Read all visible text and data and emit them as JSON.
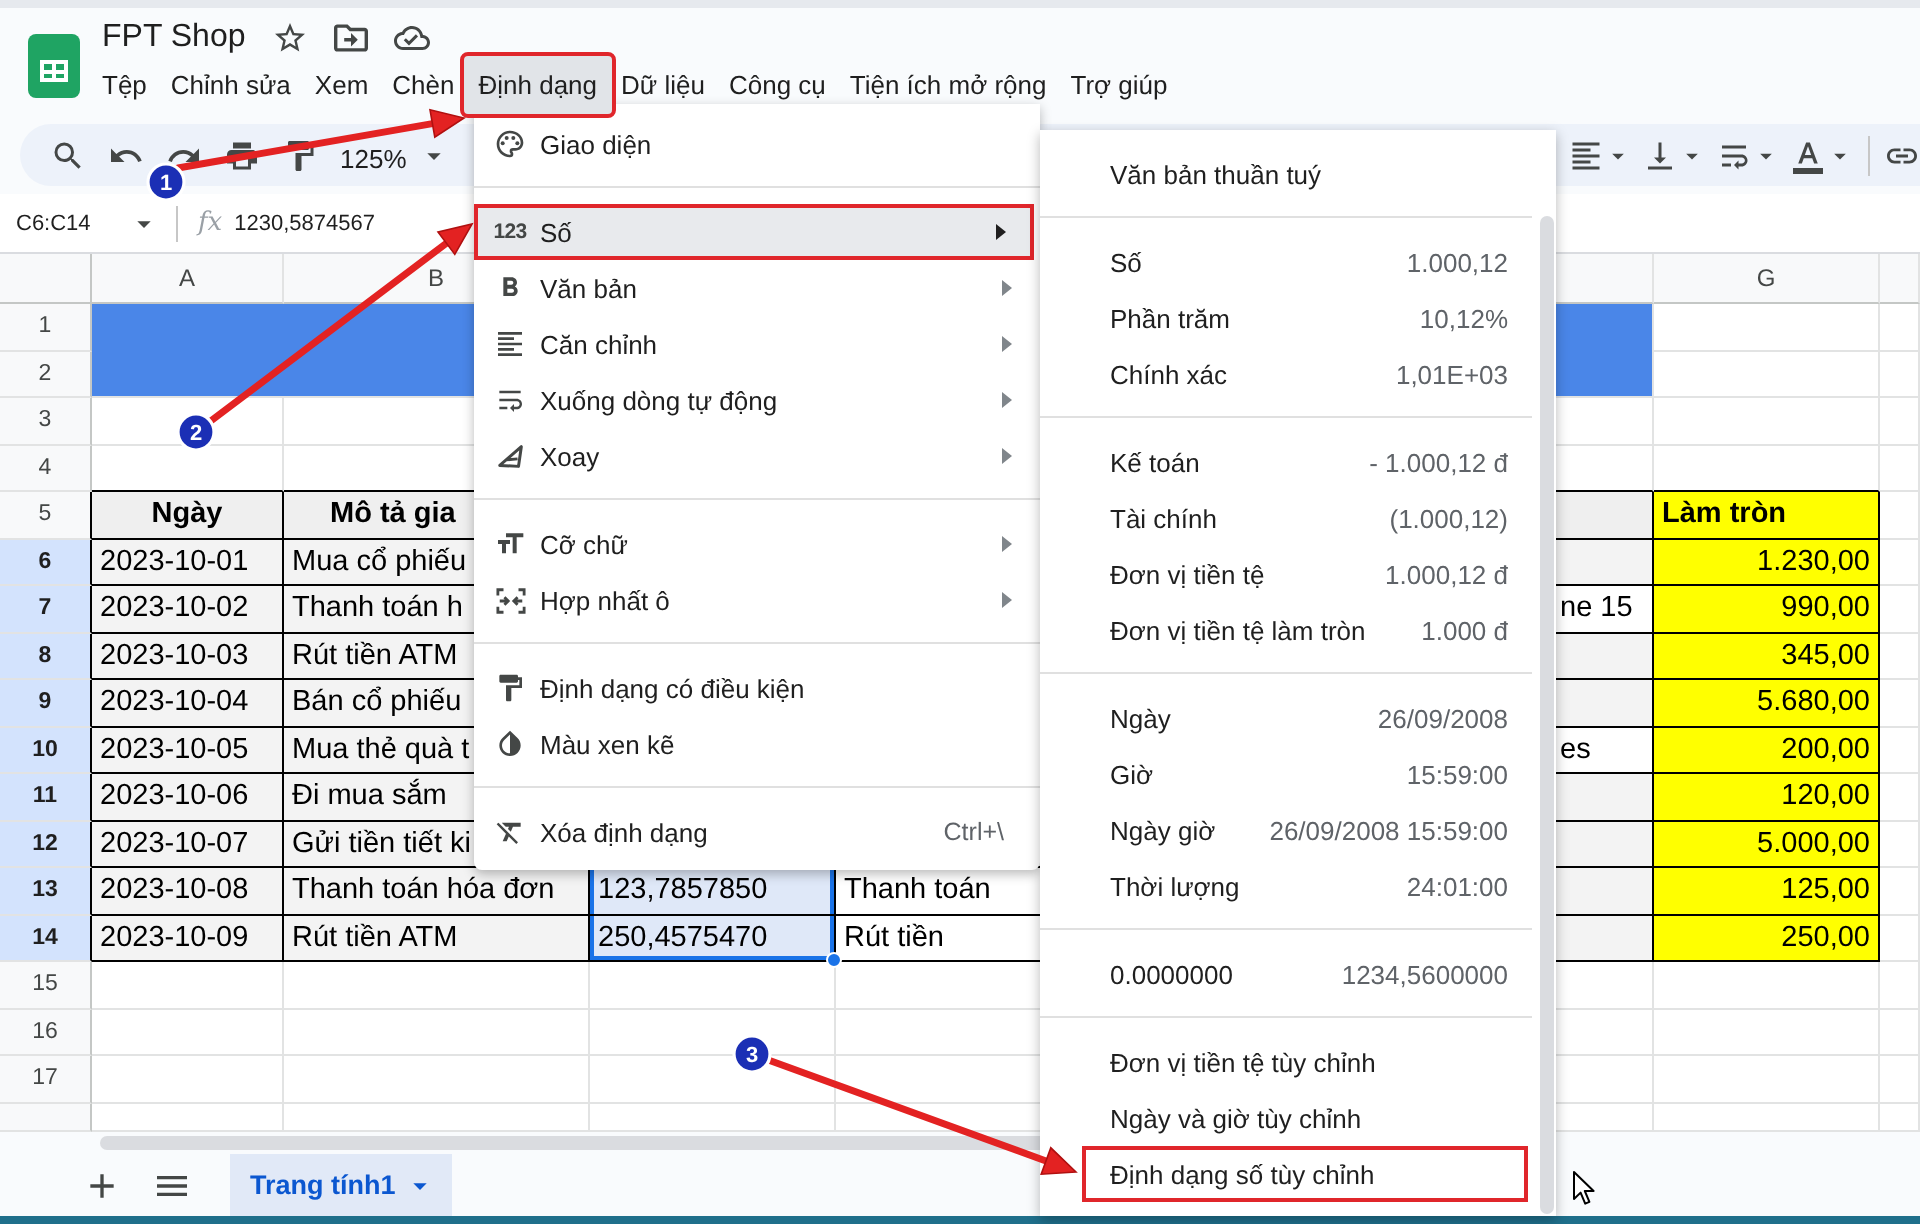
{
  "document": {
    "title": "FPT Shop"
  },
  "menubar": [
    {
      "label": "Tệp",
      "selected": false,
      "boxed": false
    },
    {
      "label": "Chỉnh sửa",
      "selected": false,
      "boxed": false
    },
    {
      "label": "Xem",
      "selected": false,
      "boxed": false
    },
    {
      "label": "Chèn",
      "selected": false,
      "boxed": false
    },
    {
      "label": "Định dạng",
      "selected": true,
      "boxed": true
    },
    {
      "label": "Dữ liệu",
      "selected": false,
      "boxed": false
    },
    {
      "label": "Công cụ",
      "selected": false,
      "boxed": false
    },
    {
      "label": "Tiện ích mở rộng",
      "selected": false,
      "boxed": false
    },
    {
      "label": "Trợ giúp",
      "selected": false,
      "boxed": false
    }
  ],
  "toolbar": {
    "zoom": "125%"
  },
  "formula_bar": {
    "name_box": "C6:C14",
    "fx_label": "fx",
    "formula": "1230,5874567"
  },
  "grid": {
    "column_headers": {
      "column_a": "A",
      "column_b": "B",
      "column_g": "G"
    },
    "rows": [
      {
        "number": "1",
        "kind": "banner",
        "selected": false
      },
      {
        "number": "2",
        "kind": "banner",
        "selected": false
      },
      {
        "number": "3",
        "kind": "blank",
        "selected": false
      },
      {
        "number": "4",
        "kind": "blank",
        "selected": false
      },
      {
        "number": "5",
        "kind": "table_header",
        "selected": false,
        "column_a": "Ngày",
        "column_b": "Mô tả gia",
        "column_g": "Làm tròn"
      },
      {
        "number": "6",
        "kind": "table_row",
        "selected": true,
        "column_a": "2023-10-01",
        "column_b": "Mua cổ phiếu",
        "column_g": "1.230,00"
      },
      {
        "number": "7",
        "kind": "table_row",
        "selected": true,
        "column_a": "2023-10-02",
        "column_b": "Thanh toán h",
        "column_f": "ne 15",
        "column_g": "990,00"
      },
      {
        "number": "8",
        "kind": "table_row",
        "selected": true,
        "column_a": "2023-10-03",
        "column_b": "Rút tiền ATM",
        "column_g": "345,00"
      },
      {
        "number": "9",
        "kind": "table_row",
        "selected": true,
        "column_a": "2023-10-04",
        "column_b": "Bán cổ phiếu",
        "column_g": "5.680,00"
      },
      {
        "number": "10",
        "kind": "table_row",
        "selected": true,
        "column_a": "2023-10-05",
        "column_b": "Mua thẻ quà t",
        "column_f": "es",
        "column_g": "200,00"
      },
      {
        "number": "11",
        "kind": "table_row",
        "selected": true,
        "column_a": "2023-10-06",
        "column_b": "Đi mua sắm",
        "column_g": "120,00"
      },
      {
        "number": "12",
        "kind": "table_row",
        "selected": true,
        "column_a": "2023-10-07",
        "column_b": "Gửi tiền tiết ki",
        "column_g": "5.000,00"
      },
      {
        "number": "13",
        "kind": "table_row",
        "selected": true,
        "column_a": "2023-10-08",
        "column_b": "Thanh toán hóa đơn",
        "column_c": "123,7857850",
        "column_d": "Thanh toán",
        "column_g": "125,00"
      },
      {
        "number": "14",
        "kind": "table_row",
        "selected": true,
        "column_a": "2023-10-09",
        "column_b": "Rút tiền ATM",
        "column_c": "250,4575470",
        "column_d": "Rút tiền",
        "column_g": "250,00"
      },
      {
        "number": "15",
        "kind": "blank",
        "selected": false
      },
      {
        "number": "16",
        "kind": "blank",
        "selected": false
      },
      {
        "number": "17",
        "kind": "blank",
        "selected": false
      },
      {
        "kind": "partial",
        "selected": false
      }
    ]
  },
  "sheet_tabs": [
    {
      "label": "Trang tính1",
      "selected": true
    }
  ],
  "format_menu": {
    "groups": [
      [
        {
          "label": "Giao diện",
          "submenu": false,
          "selected": false,
          "boxed": false
        }
      ],
      [
        {
          "label": "Số",
          "glyph": "123",
          "submenu": true,
          "selected": true,
          "boxed": true
        },
        {
          "label": "Văn bản",
          "submenu": true,
          "selected": false,
          "boxed": false
        },
        {
          "label": "Căn chỉnh",
          "submenu": true,
          "selected": false,
          "boxed": false
        },
        {
          "label": "Xuống dòng tự động",
          "submenu": true,
          "selected": false,
          "boxed": false
        },
        {
          "label": "Xoay",
          "submenu": true,
          "selected": false,
          "boxed": false
        }
      ],
      [
        {
          "label": "Cỡ chữ",
          "submenu": true,
          "selected": false,
          "boxed": false
        },
        {
          "label": "Hợp nhất ô",
          "submenu": true,
          "selected": false,
          "boxed": false
        }
      ],
      [
        {
          "label": "Định dạng có điều kiện",
          "submenu": false,
          "selected": false,
          "boxed": false
        },
        {
          "label": "Màu xen kẽ",
          "submenu": false,
          "selected": false,
          "boxed": false
        }
      ],
      [
        {
          "label": "Xóa định dạng",
          "shortcut": "Ctrl+\\",
          "submenu": false,
          "selected": false,
          "boxed": false
        }
      ]
    ]
  },
  "number_submenu": {
    "groups": [
      [
        {
          "label": "Văn bản thuần tuý",
          "selected": false,
          "boxed": false
        }
      ],
      [
        {
          "label": "Số",
          "example": "1.000,12",
          "selected": false,
          "boxed": false
        },
        {
          "label": "Phần trăm",
          "example": "10,12%",
          "selected": false,
          "boxed": false
        },
        {
          "label": "Chính xác",
          "example": "1,01E+03",
          "selected": false,
          "boxed": false
        }
      ],
      [
        {
          "label": "Kế toán",
          "example": "- 1.000,12 đ",
          "selected": false,
          "boxed": false
        },
        {
          "label": "Tài chính",
          "example": "(1.000,12)",
          "selected": false,
          "boxed": false
        },
        {
          "label": "Đơn vị tiền tệ",
          "example": "1.000,12 đ",
          "selected": false,
          "boxed": false
        },
        {
          "label": "Đơn vị tiền tệ làm tròn",
          "example": "1.000 đ",
          "selected": false,
          "boxed": false
        }
      ],
      [
        {
          "label": "Ngày",
          "example": "26/09/2008",
          "selected": false,
          "boxed": false
        },
        {
          "label": "Giờ",
          "example": "15:59:00",
          "selected": false,
          "boxed": false
        },
        {
          "label": "Ngày giờ",
          "example": "26/09/2008 15:59:00",
          "selected": false,
          "boxed": false
        },
        {
          "label": "Thời lượng",
          "example": "24:01:00",
          "selected": false,
          "boxed": false
        }
      ],
      [
        {
          "label": "0.0000000",
          "example": "1234,5600000",
          "selected": false,
          "boxed": false
        }
      ],
      [
        {
          "label": "Đơn vị tiền tệ tùy chỉnh",
          "selected": false,
          "boxed": false
        },
        {
          "label": "Ngày và giờ tùy chỉnh",
          "selected": false,
          "boxed": false
        },
        {
          "label": "Định dạng số tùy chỉnh",
          "selected": false,
          "boxed": true
        }
      ]
    ]
  },
  "callouts": [
    {
      "number": "1"
    },
    {
      "number": "2"
    },
    {
      "number": "3"
    }
  ]
}
